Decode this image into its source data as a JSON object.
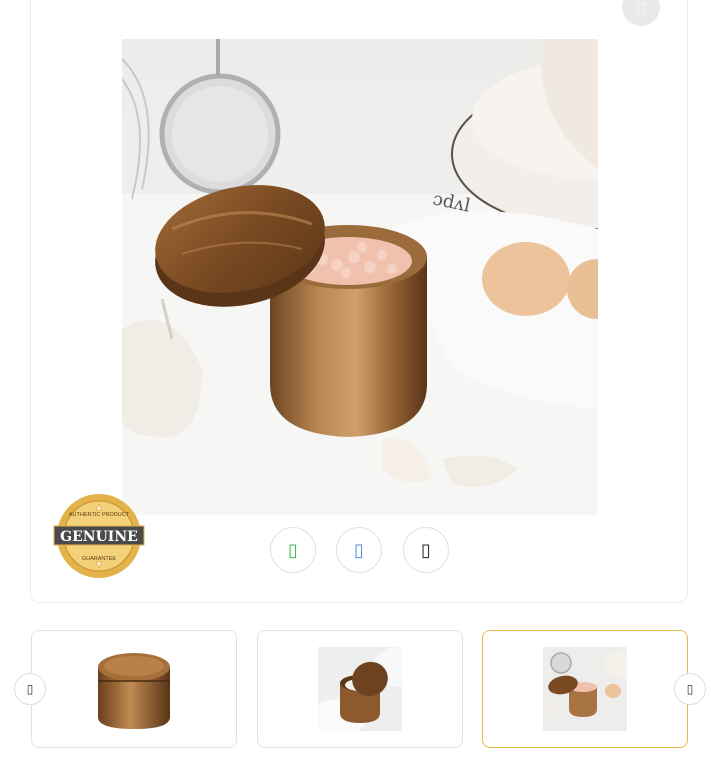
{
  "gallery": {
    "zoom_icon": "□",
    "badge": {
      "title": "GENUINE",
      "top_text": "AUTHENTIC PRODUCT",
      "bottom_text": "GUARANTEE"
    },
    "share": [
      {
        "name": "share-green-icon",
        "glyph": "▯",
        "color": "#3bb54a"
      },
      {
        "name": "share-blue-icon",
        "glyph": "▯",
        "color": "#4a90d9"
      },
      {
        "name": "share-dark-icon",
        "glyph": "▯",
        "color": "#222222"
      }
    ],
    "prev_icon": "▯",
    "next_icon": "▯",
    "selected_thumbnail": 3,
    "colors": {
      "active_border": "#e8b84a",
      "wood": "#8a5a2e"
    }
  }
}
